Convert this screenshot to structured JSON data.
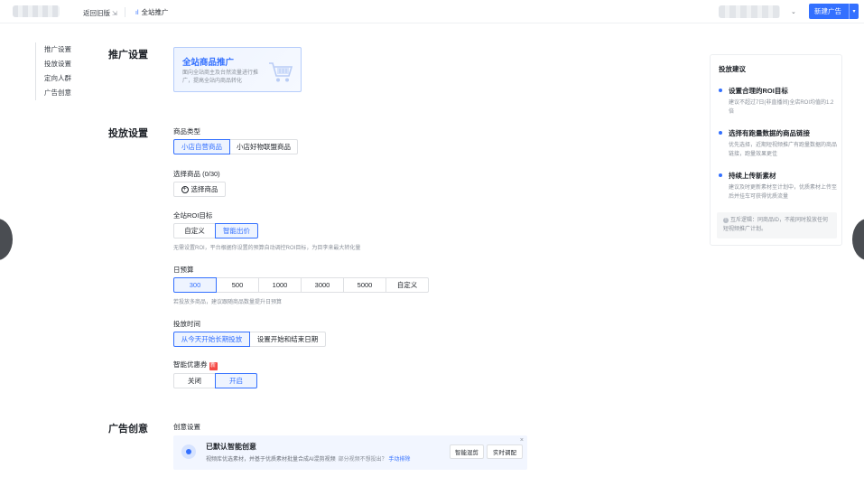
{
  "topbar": {
    "back_label": "返回旧版",
    "promo_label": "全站推广",
    "new_ad_label": "新建广告"
  },
  "leftnav": {
    "items": [
      "推广设置",
      "投放设置",
      "定向人群",
      "广告创意"
    ]
  },
  "promotion": {
    "section_title": "推广设置",
    "card_title": "全站商品推广",
    "card_desc": "面向全站商主及台然流量进行推广，提高全站内商品转化"
  },
  "delivery": {
    "section_title": "投放设置",
    "product_type": {
      "label": "商品类型",
      "options": [
        "小店自营商品",
        "小店好物联盟商品"
      ],
      "selected": "小店自营商品"
    },
    "select_products": {
      "label": "选择商品 (0/30)",
      "button": "选择商品"
    },
    "roi_target": {
      "label": "全站ROI目标",
      "options": [
        "自定义",
        "智能出价"
      ],
      "selected": "智能出价",
      "hint": "无需设置ROI，平台根据你设置的预算自动调控ROI目标，为目李来最大转化量"
    },
    "daily_budget": {
      "label": "日预算",
      "options": [
        "300",
        "500",
        "1000",
        "3000",
        "5000",
        "自定义"
      ],
      "selected": "300",
      "hint": "若投放多商品，建议跟随商品数量提升日预算"
    },
    "schedule": {
      "label": "投放时间",
      "options": [
        "从今天开始长期投放",
        "设置开始和结束日期"
      ],
      "selected": "从今天开始长期投放"
    },
    "coupon": {
      "label": "智能优惠券",
      "badge": "新",
      "options": [
        "关闭",
        "开启"
      ],
      "selected": "开启"
    }
  },
  "creative": {
    "section_title": "广告创意",
    "subsection": "创意设置",
    "box_title": "已默认智能创意",
    "box_desc": "视频库优选素材，并基于优质素材批量合成AI混剪视频",
    "box_muted": "部分视频不想投出？",
    "box_link": "手动排除",
    "buttons": [
      "智能混剪",
      "实时调配"
    ]
  },
  "suggestions": {
    "title": "投放建议",
    "items": [
      {
        "heading": "设置合理的ROI目标",
        "body": "建议不超过7日(非直播间)全店ROI均值的1.2倍"
      },
      {
        "heading": "选择有跑量数据的商品链接",
        "body": "优先选择，近期短视频推广有跑量数据的商品链接，跑量效果更佳"
      },
      {
        "heading": "持续上传新素材",
        "body": "建议及时更新素材至计划中，优质素材上传至后并挂车可获得优质流量"
      }
    ],
    "tip": "互斥逻辑：同商品ID，不能同时投放任何短视频推广计划。"
  }
}
